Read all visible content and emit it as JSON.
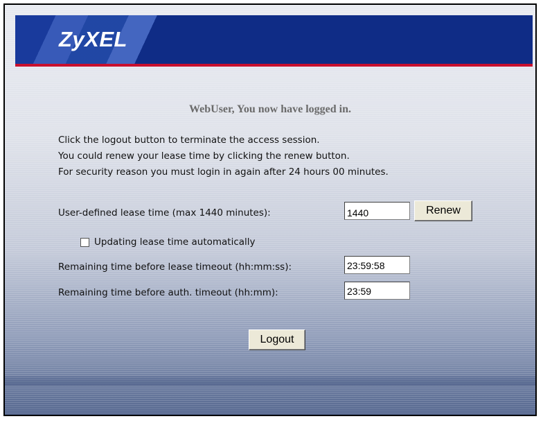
{
  "header": {
    "logo_text": "ZyXEL",
    "bg_color": "#0f2c86",
    "stripe_color": "#c8102e"
  },
  "title": "WebUser, You now have logged in.",
  "info": {
    "line1": "Click the logout button to terminate the access session.",
    "line2": "You could renew your lease time by clicking the renew button.",
    "line3": "For security reason you must login in again after 24 hours 00 minutes."
  },
  "lease": {
    "label": "User-defined lease time (max 1440 minutes):",
    "value": "1440",
    "renew_label": "Renew"
  },
  "auto_update": {
    "label": "Updating lease time automatically",
    "checked": false
  },
  "remaining_lease": {
    "label": "Remaining time before lease timeout (hh:mm:ss):",
    "value": "23:59:58"
  },
  "remaining_auth": {
    "label": "Remaining time before auth. timeout (hh:mm):",
    "value": "23:59"
  },
  "logout_label": "Logout"
}
